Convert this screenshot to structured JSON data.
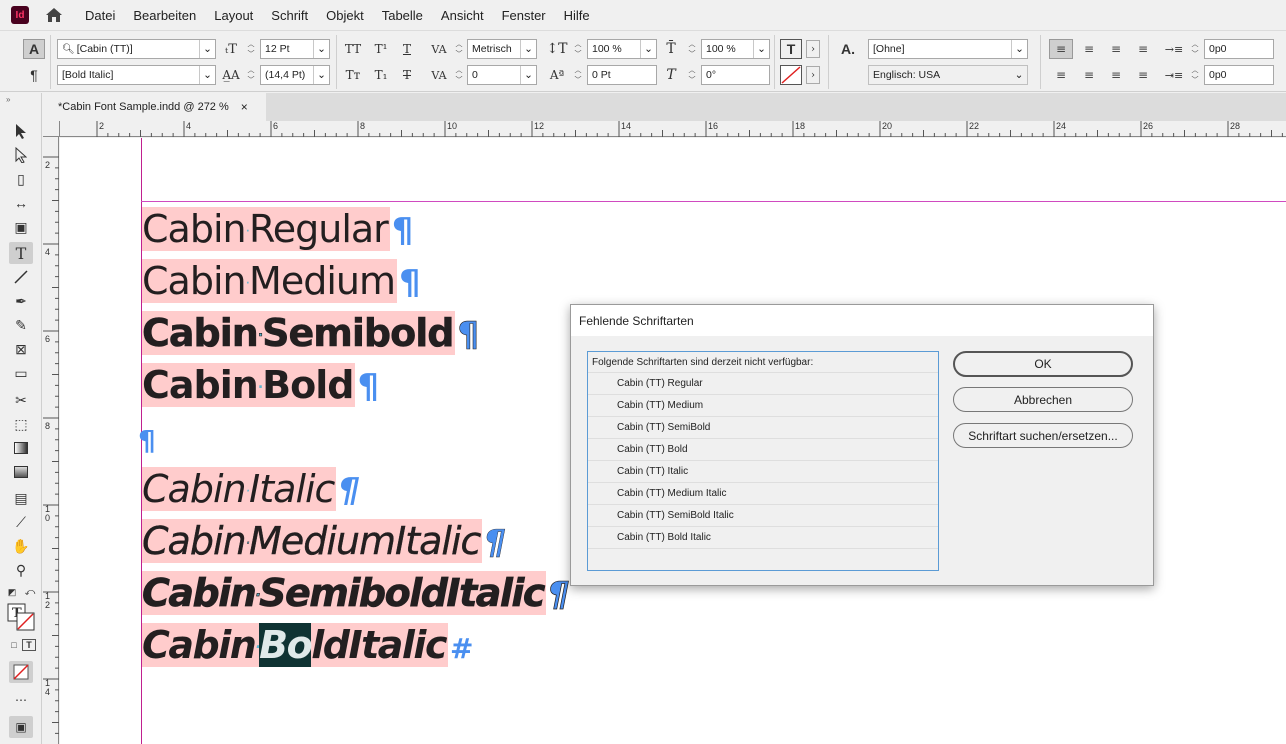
{
  "app": {
    "logo_text": "Id"
  },
  "menu": [
    "Datei",
    "Bearbeiten",
    "Layout",
    "Schrift",
    "Objekt",
    "Tabelle",
    "Ansicht",
    "Fenster",
    "Hilfe"
  ],
  "control": {
    "font_family": "[Cabin (TT)]",
    "font_style": "[Bold Italic]",
    "font_size": "12 Pt",
    "leading": "(14,4 Pt)",
    "kerning": "Metrisch",
    "tracking": "0",
    "vertical_scale": "100 %",
    "horizontal_scale": "100 %",
    "baseline_shift": "0 Pt",
    "skew": "0°",
    "char_style": "[Ohne]",
    "language": "Englisch: USA",
    "left_indent": "0p0",
    "first_line_indent": "0p0"
  },
  "tab": {
    "title": "*Cabin Font Sample.indd @ 272 %",
    "close": "×"
  },
  "ruler_top": [
    "2",
    "4",
    "6",
    "8",
    "10",
    "12",
    "14",
    "16",
    "18",
    "20",
    "22",
    "24",
    "26",
    "28"
  ],
  "ruler_left": [
    "2",
    "4",
    "6",
    "8",
    "1 0",
    "1 2",
    "1 4"
  ],
  "document_lines": {
    "l1_a": "Cabin",
    "l1_b": "Regular",
    "l2_a": "Cabin",
    "l2_b": "Medium",
    "l3_a": "Cabin",
    "l3_b": "Semibold",
    "l4_a": "Cabin",
    "l4_b": "Bold",
    "l5_a": "Cabin",
    "l5_b": "Italic",
    "l6_a": "Cabin",
    "l6_b": "MediumItalic",
    "l7_a": "Cabin",
    "l7_b": "SemiboldItalic",
    "l8_a": "Cabin",
    "l8_sel": "Bo",
    "l8_b": "ldItalic",
    "pilcrow": "¶",
    "story_end": "#",
    "space_dot": "·"
  },
  "dialog": {
    "title": "Fehlende Schriftarten",
    "list_header": "Folgende Schriftarten sind derzeit nicht verfügbar:",
    "fonts": [
      "Cabin (TT) Regular",
      "Cabin (TT) Medium",
      "Cabin (TT) SemiBold",
      "Cabin (TT) Bold",
      "Cabin (TT) Italic",
      "Cabin (TT) Medium Italic",
      "Cabin (TT) SemiBold Italic",
      "Cabin (TT) Bold Italic"
    ],
    "ok": "OK",
    "cancel": "Abbrechen",
    "find_replace": "Schriftart suchen/ersetzen..."
  }
}
